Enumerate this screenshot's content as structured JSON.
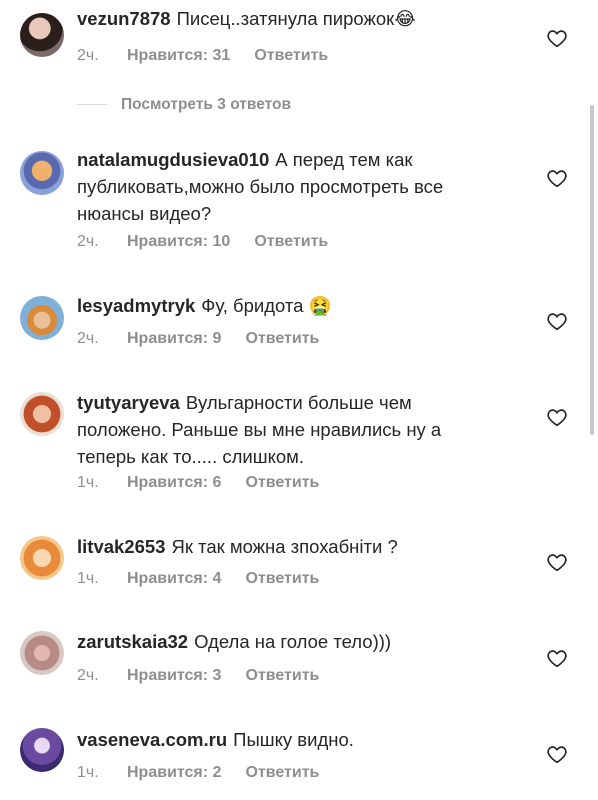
{
  "comments": [
    {
      "username": "vezun7878",
      "text": "Писец..затянула пирожок😂",
      "time": "2ч.",
      "likes": "Нравится: 31",
      "reply": "Ответить"
    },
    {
      "username": "natalamugdusieva010",
      "text": "А перед тем как публиковать,можно было просмотреть все нюансы видео?",
      "time": "2ч.",
      "likes": "Нравится: 10",
      "reply": "Ответить"
    },
    {
      "username": "lesyadmytryk",
      "text": "Фу, бридота 🤮",
      "time": "2ч.",
      "likes": "Нравится: 9",
      "reply": "Ответить"
    },
    {
      "username": "tyutyaryeva",
      "text": "Вульгарности больше чем положено. Раньше вы мне нравились ну а теперь  как то..... слишком.",
      "time": "1ч.",
      "likes": "Нравится: 6",
      "reply": "Ответить"
    },
    {
      "username": "litvak2653",
      "text": "Як так можна зпохабніти ?",
      "time": "1ч.",
      "likes": "Нравится: 4",
      "reply": "Ответить"
    },
    {
      "username": "zarutskaia32",
      "text": "Одела на голое тело)))",
      "time": "2ч.",
      "likes": "Нравится: 3",
      "reply": "Ответить"
    },
    {
      "username": "vaseneva.com.ru",
      "text": "Пышку видно.",
      "time": "1ч.",
      "likes": "Нравится: 2",
      "reply": "Ответить"
    }
  ],
  "view_replies": "Посмотреть 3 ответов",
  "icons": {
    "like": "heart-outline-icon"
  },
  "colors": {
    "text": "#262626",
    "muted": "#8e8e8e",
    "divider": "#dbdbdb"
  }
}
